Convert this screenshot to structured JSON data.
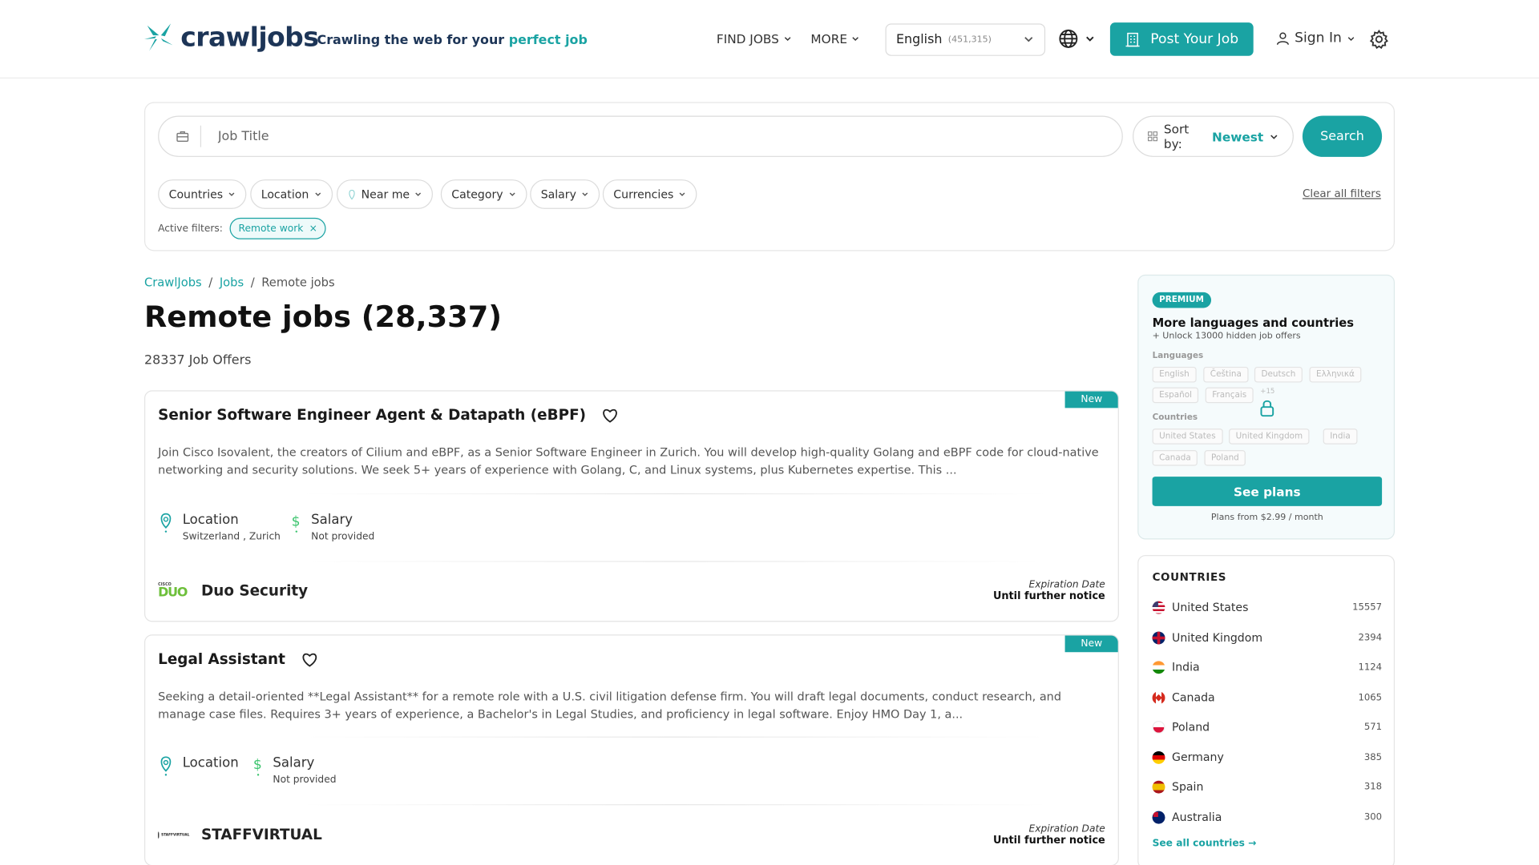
{
  "header": {
    "logo_text": "crawljobs",
    "tagline_prefix": "Crawling the web for your",
    "tagline_highlight": "perfect job",
    "nav": {
      "find_jobs": "FIND JOBS",
      "more": "MORE"
    },
    "language": {
      "label": "English",
      "count": "(451,315)"
    },
    "post_job": "Post Your Job",
    "sign_in": "Sign In"
  },
  "search": {
    "placeholder": "Job Title",
    "sort_label": "Sort by:",
    "sort_value": "Newest",
    "button": "Search"
  },
  "filters": {
    "chips": [
      "Countries",
      "Location",
      "Near me",
      "Category",
      "Salary",
      "Currencies"
    ],
    "clear_all": "Clear all filters",
    "active_label": "Active filters:",
    "active": "Remote work"
  },
  "breadcrumb": {
    "home": "CrawlJobs",
    "jobs": "Jobs",
    "current": "Remote jobs"
  },
  "page_title": "Remote jobs (28,337)",
  "offers_count": "28337 Job Offers",
  "jobs": [
    {
      "badge": "New",
      "title": "Senior Software Engineer Agent & Datapath (eBPF)",
      "description": "Join Cisco Isovalent, the creators of Cilium and eBPF, as a Senior Software Engineer in Zurich. You will develop high-quality Golang and eBPF code for cloud-native networking and security solutions. We seek 5+ years of experience with Golang, C, and Linux systems, plus Kubernetes expertise. This ...",
      "location_label": "Location",
      "location_value": "Switzerland , Zurich",
      "salary_label": "Salary",
      "salary_value": "Not provided",
      "company": "Duo Security",
      "company_logo_small": "CISCO",
      "company_logo_big": "DUO",
      "expiration_label": "Expiration Date",
      "expiration_value": "Until further notice"
    },
    {
      "badge": "New",
      "title": "Legal Assistant",
      "description": "Seeking a detail-oriented **Legal Assistant** for a remote role with a U.S. civil litigation defense firm. You will draft legal documents, conduct research, and manage case files. Requires 3+ years of experience, a Bachelor's in Legal Studies, and proficiency in legal software. Enjoy HMO Day 1, a...",
      "location_label": "Location",
      "salary_label": "Salary",
      "salary_value": "Not provided",
      "company": "STAFFVIRTUAL",
      "company_logo_small": "STAFFVIRTUAL",
      "expiration_label": "Expiration Date",
      "expiration_value": "Until further notice"
    }
  ],
  "premium": {
    "badge": "PREMIUM",
    "title": "More languages and countries",
    "subtitle": "+ Unlock 13000 hidden job offers",
    "languages_label": "Languages",
    "languages": [
      "English",
      "Čeština",
      "Deutsch",
      "Ελληνικά",
      "Español",
      "Français"
    ],
    "languages_more": "+15",
    "countries_label": "Countries",
    "countries": [
      "United States",
      "United Kingdom",
      "India",
      "Canada",
      "Poland"
    ],
    "button": "See plans",
    "price_note": "Plans from $2.99 / month"
  },
  "countries_panel": {
    "title": "COUNTRIES",
    "items": [
      {
        "name": "United States",
        "count": "15557"
      },
      {
        "name": "United Kingdom",
        "count": "2394"
      },
      {
        "name": "India",
        "count": "1124"
      },
      {
        "name": "Canada",
        "count": "1065"
      },
      {
        "name": "Poland",
        "count": "571"
      },
      {
        "name": "Germany",
        "count": "385"
      },
      {
        "name": "Spain",
        "count": "318"
      },
      {
        "name": "Australia",
        "count": "300"
      }
    ],
    "see_all": "See all countries →"
  },
  "colors": {
    "accent": "#1aa3a3",
    "brand_dark": "#1d3557"
  }
}
